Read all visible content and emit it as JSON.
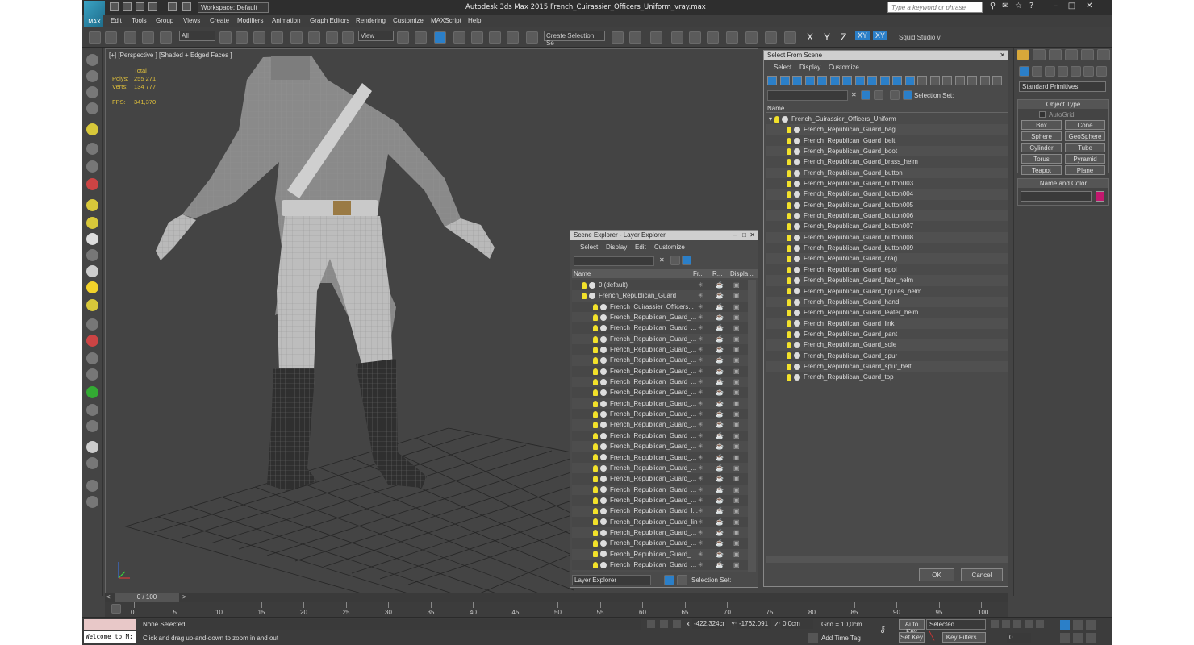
{
  "window": {
    "app_title": "Autodesk 3ds Max  2015     French_Cuirassier_Officers_Uniform_vray.max",
    "logo_text": "MAX",
    "workspace": "Workspace: Default",
    "search_placeholder": "Type a keyword or phrase"
  },
  "menus": [
    "Edit",
    "Tools",
    "Group",
    "Views",
    "Create",
    "Modifiers",
    "Animation",
    "Graph Editors",
    "Rendering",
    "Customize",
    "MAXScript",
    "Help"
  ],
  "toolbar": {
    "filter_all": "All",
    "view": "View",
    "create_selection_set": "Create Selection Se",
    "axis_x": "X",
    "axis_y": "Y",
    "axis_z": "Z",
    "axis_xy": "XY",
    "axis_xy2": "XY",
    "studio": "Squid Studio v"
  },
  "viewport": {
    "label": "[+] [Perspective ] [Shaded + Edged Faces ]",
    "total_label": "Total",
    "polys_label": "Polys:",
    "polys": "255 271",
    "verts_label": "Verts:",
    "verts": "134 777",
    "fps_label": "FPS:",
    "fps": "341,370"
  },
  "scene_explorer": {
    "title": "Scene Explorer - Layer Explorer",
    "menu": [
      "Select",
      "Display",
      "Edit",
      "Customize"
    ],
    "columns": [
      "Name",
      "Fr...",
      "R...",
      "Displa..."
    ],
    "rows": [
      "0 (default)",
      "French_Republican_Guard",
      "French_Cuirassier_Officers...",
      "French_Republican_Guard_...",
      "French_Republican_Guard_...",
      "French_Republican_Guard_...",
      "French_Republican_Guard_...",
      "French_Republican_Guard_...",
      "French_Republican_Guard_...",
      "French_Republican_Guard_...",
      "French_Republican_Guard_...",
      "French_Republican_Guard_...",
      "French_Republican_Guard_...",
      "French_Republican_Guard_...",
      "French_Republican_Guard_...",
      "French_Republican_Guard_...",
      "French_Republican_Guard_...",
      "French_Republican_Guard_...",
      "French_Republican_Guard_...",
      "French_Republican_Guard_...",
      "French_Republican_Guard_...",
      "French_Republican_Guard_l...",
      "French_Republican_Guard_link",
      "French_Republican_Guard_...",
      "French_Republican_Guard_...",
      "French_Republican_Guard_...",
      "French_Republican_Guard_...",
      "French_Republican_Guard_..."
    ],
    "footer_dropdown": "Layer Explorer",
    "footer_selection": "Selection Set:"
  },
  "select_from_scene": {
    "title": "Select From Scene",
    "menu": [
      "Select",
      "Display",
      "Customize"
    ],
    "selection_set": "Selection Set:",
    "column_name": "Name",
    "root": "French_Cuirassier_Officers_Uniform",
    "items": [
      "French_Republican_Guard_bag",
      "French_Republican_Guard_belt",
      "French_Republican_Guard_boot",
      "French_Republican_Guard_brass_helm",
      "French_Republican_Guard_button",
      "French_Republican_Guard_button003",
      "French_Republican_Guard_button004",
      "French_Republican_Guard_button005",
      "French_Republican_Guard_button006",
      "French_Republican_Guard_button007",
      "French_Republican_Guard_button008",
      "French_Republican_Guard_button009",
      "French_Republican_Guard_crag",
      "French_Republican_Guard_epol",
      "French_Republican_Guard_fabr_helm",
      "French_Republican_Guard_figures_helm",
      "French_Republican_Guard_hand",
      "French_Republican_Guard_leater_helm",
      "French_Republican_Guard_link",
      "French_Republican_Guard_pant",
      "French_Republican_Guard_sole",
      "French_Republican_Guard_spur",
      "French_Republican_Guard_spur_belt",
      "French_Republican_Guard_top"
    ],
    "ok": "OK",
    "cancel": "Cancel"
  },
  "command_panel": {
    "dropdown": "Standard Primitives",
    "object_type": "Object Type",
    "autogrid": "AutoGrid",
    "buttons": [
      "Box",
      "Cone",
      "Sphere",
      "GeoSphere",
      "Cylinder",
      "Tube",
      "Torus",
      "Pyramid",
      "Teapot",
      "Plane"
    ],
    "name_and_color": "Name and Color",
    "swatch_color": "#c2186e"
  },
  "timeline": {
    "slider": "0 / 100",
    "ticks": [
      "0",
      "5",
      "10",
      "15",
      "20",
      "25",
      "30",
      "35",
      "40",
      "45",
      "50",
      "55",
      "60",
      "65",
      "70",
      "75",
      "80",
      "85",
      "90",
      "95",
      "100"
    ]
  },
  "status": {
    "listener": "Welcome to M:",
    "none_selected": "None Selected",
    "prompt": "Click and drag up-and-down to zoom in and out",
    "x_label": "X:",
    "x": "-422,324cr",
    "y_label": "Y:",
    "y": "-1762,091",
    "z_label": "Z:",
    "z": "0,0cm",
    "grid": "Grid = 10,0cm",
    "add_time_tag": "Add Time Tag",
    "auto_key": "Auto Key",
    "set_key": "Set Key",
    "selected": "Selected",
    "key_filters": "Key Filters...",
    "frame": "0"
  }
}
